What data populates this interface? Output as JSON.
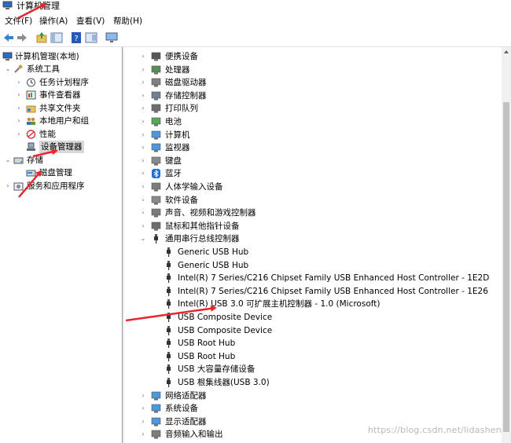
{
  "window": {
    "title": "计算机管理"
  },
  "menubar": [
    "文件(F)",
    "操作(A)",
    "查看(V)",
    "帮助(H)"
  ],
  "toolbar": {
    "icons": [
      "back-arrow-icon",
      "forward-arrow-icon",
      "up-folder-icon",
      "console-tree-icon",
      "help-icon",
      "properties-icon",
      "monitor-icon"
    ]
  },
  "left_tree": {
    "root": "计算机管理(本地)",
    "system_tools": "系统工具",
    "task_scheduler": "任务计划程序",
    "event_viewer": "事件查看器",
    "shared_folders": "共享文件夹",
    "local_users": "本地用户和组",
    "performance": "性能",
    "device_manager": "设备管理器",
    "storage": "存储",
    "disk_management": "磁盘管理",
    "services_apps": "服务和应用程序"
  },
  "device_tree": {
    "categories_top": [
      {
        "label": "便携设备",
        "icon": "portable-device-icon"
      },
      {
        "label": "处理器",
        "icon": "processor-icon"
      },
      {
        "label": "磁盘驱动器",
        "icon": "disk-drive-icon"
      },
      {
        "label": "存储控制器",
        "icon": "storage-controller-icon"
      },
      {
        "label": "打印队列",
        "icon": "print-queue-icon"
      },
      {
        "label": "电池",
        "icon": "battery-icon"
      },
      {
        "label": "计算机",
        "icon": "computer-icon"
      },
      {
        "label": "监视器",
        "icon": "monitor-icon"
      },
      {
        "label": "键盘",
        "icon": "keyboard-icon"
      },
      {
        "label": "蓝牙",
        "icon": "bluetooth-icon"
      },
      {
        "label": "人体学输入设备",
        "icon": "hid-icon"
      },
      {
        "label": "软件设备",
        "icon": "software-device-icon"
      },
      {
        "label": "声音、视频和游戏控制器",
        "icon": "sound-icon"
      },
      {
        "label": "鼠标和其他指针设备",
        "icon": "mouse-icon"
      }
    ],
    "usb_category": "通用串行总线控制器",
    "usb_children": [
      "Generic USB Hub",
      "Generic USB Hub",
      "Intel(R) 7 Series/C216 Chipset Family USB Enhanced Host Controller - 1E2D",
      "Intel(R) 7 Series/C216 Chipset Family USB Enhanced Host Controller - 1E26",
      "Intel(R) USB 3.0 可扩展主机控制器 - 1.0 (Microsoft)",
      "USB Composite Device",
      "USB Composite Device",
      "USB Root Hub",
      "USB Root Hub",
      "USB 大容量存储设备",
      "USB 根集线器(USB 3.0)"
    ],
    "categories_bottom": [
      {
        "label": "网络适配器",
        "icon": "network-adapter-icon"
      },
      {
        "label": "系统设备",
        "icon": "system-device-icon"
      },
      {
        "label": "显示适配器",
        "icon": "display-adapter-icon"
      },
      {
        "label": "音频输入和输出",
        "icon": "audio-io-icon"
      }
    ]
  },
  "watermark": "https://blog.csdn.net/lidashen",
  "colors": {
    "annotation_arrow": "#e8262b",
    "selection": "#d9d9d9",
    "scroll_thumb": "#c2c2c2"
  }
}
